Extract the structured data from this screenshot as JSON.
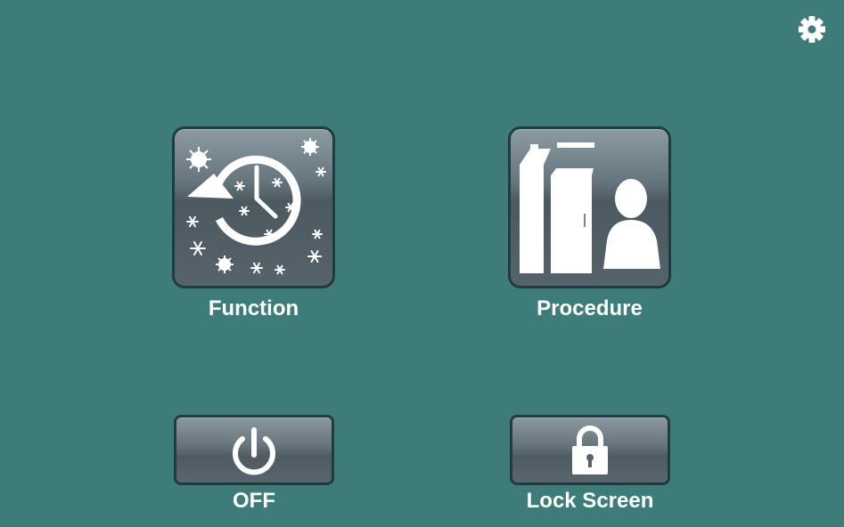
{
  "tiles": {
    "function": {
      "label": "Function",
      "icon": "clock-cycle-weather-icon"
    },
    "procedure": {
      "label": "Procedure",
      "icon": "locker-person-icon"
    },
    "off": {
      "label": "OFF",
      "icon": "power-icon"
    },
    "lock": {
      "label": "Lock Screen",
      "icon": "padlock-icon"
    }
  },
  "settings": {
    "icon": "gear-icon"
  },
  "colors": {
    "background": "#3d7c78",
    "tile_border": "#1f3c3f",
    "tile_top": "#8c9aa2",
    "tile_bottom": "#56636b",
    "text": "#ffffff"
  }
}
